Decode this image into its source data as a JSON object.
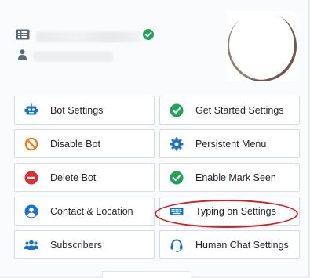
{
  "header": {
    "page_name": "",
    "user_name": ""
  },
  "buttons": [
    {
      "label": "Bot Settings",
      "icon": "robot-icon",
      "color": "#1a73c9"
    },
    {
      "label": "Get Started Settings",
      "icon": "check-circle-icon",
      "color": "#21a35a"
    },
    {
      "label": "Disable Bot",
      "icon": "ban-icon",
      "color": "#f0811e"
    },
    {
      "label": "Persistent Menu",
      "icon": "gear-icon",
      "color": "#1a73c9"
    },
    {
      "label": "Delete Bot",
      "icon": "minus-circle-icon",
      "color": "#dc3030"
    },
    {
      "label": "Enable Mark Seen",
      "icon": "check-circle-icon",
      "color": "#21a35a"
    },
    {
      "label": "Contact & Location",
      "icon": "user-circle-icon",
      "color": "#1a73c9"
    },
    {
      "label": "Typing on Settings",
      "icon": "keyboard-icon",
      "color": "#1a73c9"
    },
    {
      "label": "Subscribers",
      "icon": "users-icon",
      "color": "#1a73c9"
    },
    {
      "label": "Human Chat Settings",
      "icon": "headset-icon",
      "color": "#1a73c9"
    }
  ],
  "colors": {
    "primary": "#1a73c9",
    "success": "#21a35a",
    "warning": "#f0811e",
    "danger": "#dc3030",
    "highlight": "#d0202a"
  }
}
